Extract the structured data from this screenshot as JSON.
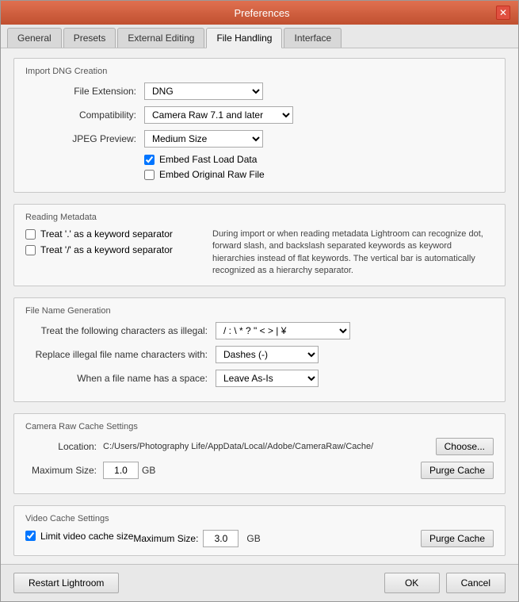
{
  "window": {
    "title": "Preferences",
    "close_label": "✕"
  },
  "tabs": [
    {
      "id": "general",
      "label": "General",
      "active": false
    },
    {
      "id": "presets",
      "label": "Presets",
      "active": false
    },
    {
      "id": "external-editing",
      "label": "External Editing",
      "active": false
    },
    {
      "id": "file-handling",
      "label": "File Handling",
      "active": true
    },
    {
      "id": "interface",
      "label": "Interface",
      "active": false
    }
  ],
  "sections": {
    "import_dng": {
      "label": "Import DNG Creation",
      "file_extension_label": "File Extension:",
      "file_extension_value": "DNG",
      "compatibility_label": "Compatibility:",
      "compatibility_value": "Camera Raw 7.1 and later",
      "jpeg_preview_label": "JPEG Preview:",
      "jpeg_preview_value": "Medium Size",
      "embed_fast_load_label": "Embed Fast Load Data",
      "embed_fast_load_checked": true,
      "embed_original_label": "Embed Original Raw File",
      "embed_original_checked": false
    },
    "reading_metadata": {
      "label": "Reading Metadata",
      "check1_label": "Treat '.' as a keyword separator",
      "check1_checked": false,
      "check2_label": "Treat '/' as a keyword separator",
      "check2_checked": false,
      "info_text": "During import or when reading metadata Lightroom can recognize dot, forward slash, and backslash separated keywords as keyword hierarchies instead of flat keywords. The vertical bar is automatically recognized as a hierarchy separator."
    },
    "file_name_generation": {
      "label": "File Name Generation",
      "illegal_chars_label": "Treat the following characters as illegal:",
      "illegal_chars_value": "/ : \\ * ? \" < > | ¥",
      "replace_label": "Replace illegal file name characters with:",
      "replace_value": "Dashes (-)",
      "space_label": "When a file name has a space:",
      "space_value": "Leave As-Is"
    },
    "camera_raw_cache": {
      "label": "Camera Raw Cache Settings",
      "location_label": "Location:",
      "location_path": "C:/Users/Photography Life/AppData/Local/Adobe/CameraRaw/Cache/",
      "choose_label": "Choose...",
      "max_size_label": "Maximum Size:",
      "max_size_value": "1.0",
      "gb_label": "GB",
      "purge_label": "Purge Cache"
    },
    "video_cache": {
      "label": "Video Cache Settings",
      "limit_label": "Limit video cache size",
      "limit_checked": true,
      "max_size_label": "Maximum Size:",
      "max_size_value": "3.0",
      "gb_label": "GB",
      "purge_label": "Purge Cache"
    }
  },
  "footer": {
    "restart_label": "Restart Lightroom",
    "ok_label": "OK",
    "cancel_label": "Cancel"
  }
}
